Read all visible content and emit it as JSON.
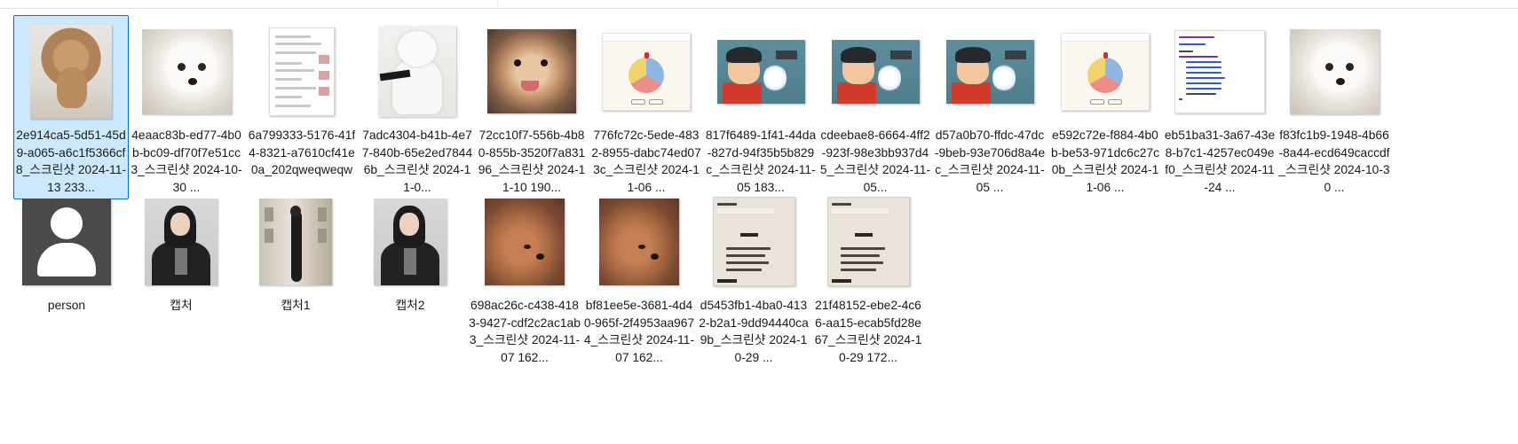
{
  "files": [
    {
      "name": "2e914ca5-5d51-45d9-a065-a6c1f5366cf8_스크린샷 2024-11-13 233...",
      "thumb": "dog-brown",
      "selected": true
    },
    {
      "name": "4eaac83b-ed77-4b0b-bc09-df70f7e51cc3_스크린샷 2024-10-30 ...",
      "thumb": "dog-white",
      "selected": false
    },
    {
      "name": "6a799333-5176-41f4-8321-a7610cf41e0a_202qweqweqw",
      "thumb": "phone-screenshot",
      "selected": false
    },
    {
      "name": "7adc4304-b41b-4e77-840b-65e2ed78446b_스크린샷 2024-11-0...",
      "thumb": "dog-standing",
      "selected": false
    },
    {
      "name": "72cc10f7-556b-4b80-855b-3520f7a83196_스크린샷 2024-11-10 190...",
      "thumb": "pomeranian",
      "selected": false
    },
    {
      "name": "776fc72c-5ede-4832-8955-dabc74ed073c_스크린샷 2024-11-06 ...",
      "thumb": "spinner-wheel",
      "selected": false
    },
    {
      "name": "817f6489-1f41-44da-827d-94f35b5b829c_스크린샷 2024-11-05 183...",
      "thumb": "cartoon",
      "selected": false
    },
    {
      "name": "cdeebae8-6664-4ff2-923f-98e3bb937d45_스크린샷 2024-11-05...",
      "thumb": "cartoon",
      "selected": false
    },
    {
      "name": "d57a0b70-ffdc-47dc-9beb-93e706d8a4ec_스크린샷 2024-11-05 ...",
      "thumb": "cartoon",
      "selected": false
    },
    {
      "name": "e592c72e-f884-4b0b-be53-971dc6c27c0b_스크린샷 2024-11-06 ...",
      "thumb": "spinner-wheel",
      "selected": false
    },
    {
      "name": "eb51ba31-3a67-43e8-b7c1-4257ec049ef0_스크린샷 2024-11-24 ...",
      "thumb": "code-editor",
      "selected": false
    },
    {
      "name": "f83fc1b9-1948-4b66-8a44-ecd649caccdf_스크린샷 2024-10-30 ...",
      "thumb": "dog-white",
      "selected": false
    },
    {
      "name": "person",
      "thumb": "person-placeholder",
      "selected": false
    },
    {
      "name": "캡처",
      "thumb": "girl-portrait",
      "selected": false
    },
    {
      "name": "캡처1",
      "thumb": "girl-street",
      "selected": false
    },
    {
      "name": "캡처2",
      "thumb": "girl-portrait",
      "selected": false
    },
    {
      "name": "698ac26c-c438-4183-9427-cdf2c2ac1ab3_스크린샷 2024-11-07 162...",
      "thumb": "fluffy-dog",
      "selected": false
    },
    {
      "name": "bf81ee5e-3681-4d40-965f-2f4953aa9674_스크린샷 2024-11-07 162...",
      "thumb": "fluffy-dog",
      "selected": false
    },
    {
      "name": "d5453fb1-4ba0-4132-b2a1-9dd94440ca9b_스크린샷 2024-10-29 ...",
      "thumb": "menu-board",
      "selected": false
    },
    {
      "name": "21f48152-ebe2-4c66-aa15-ecab5fd28e67_스크린샷 2024-10-29 172...",
      "thumb": "menu-board",
      "selected": false
    }
  ],
  "colors": {
    "selection_bg": "#cce8ff",
    "selection_border": "#0a6bd1"
  }
}
